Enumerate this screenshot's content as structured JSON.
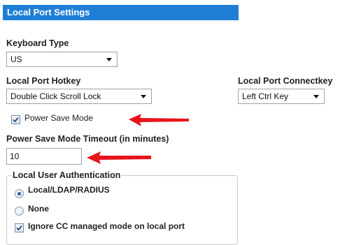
{
  "section": {
    "title": "Local Port Settings"
  },
  "keyboard_type": {
    "label": "Keyboard Type",
    "value": "US"
  },
  "hotkey": {
    "label": "Local Port Hotkey",
    "value": "Double Click Scroll Lock"
  },
  "connectkey": {
    "label": "Local Port Connectkey",
    "value": "Left Ctrl Key"
  },
  "power_save": {
    "label": "Power Save Mode",
    "checked": true
  },
  "timeout": {
    "label": "Power Save Mode Timeout (in minutes)",
    "value": "10"
  },
  "auth": {
    "legend": "Local User Authentication",
    "options": [
      {
        "label": "Local/LDAP/RADIUS",
        "selected": true
      },
      {
        "label": "None",
        "selected": false
      }
    ],
    "ignore_cc": {
      "label": "Ignore CC managed mode on local port",
      "checked": true
    }
  },
  "colors": {
    "header_bg": "#1f7fd6",
    "annotation_arrow": "#e8141c"
  }
}
